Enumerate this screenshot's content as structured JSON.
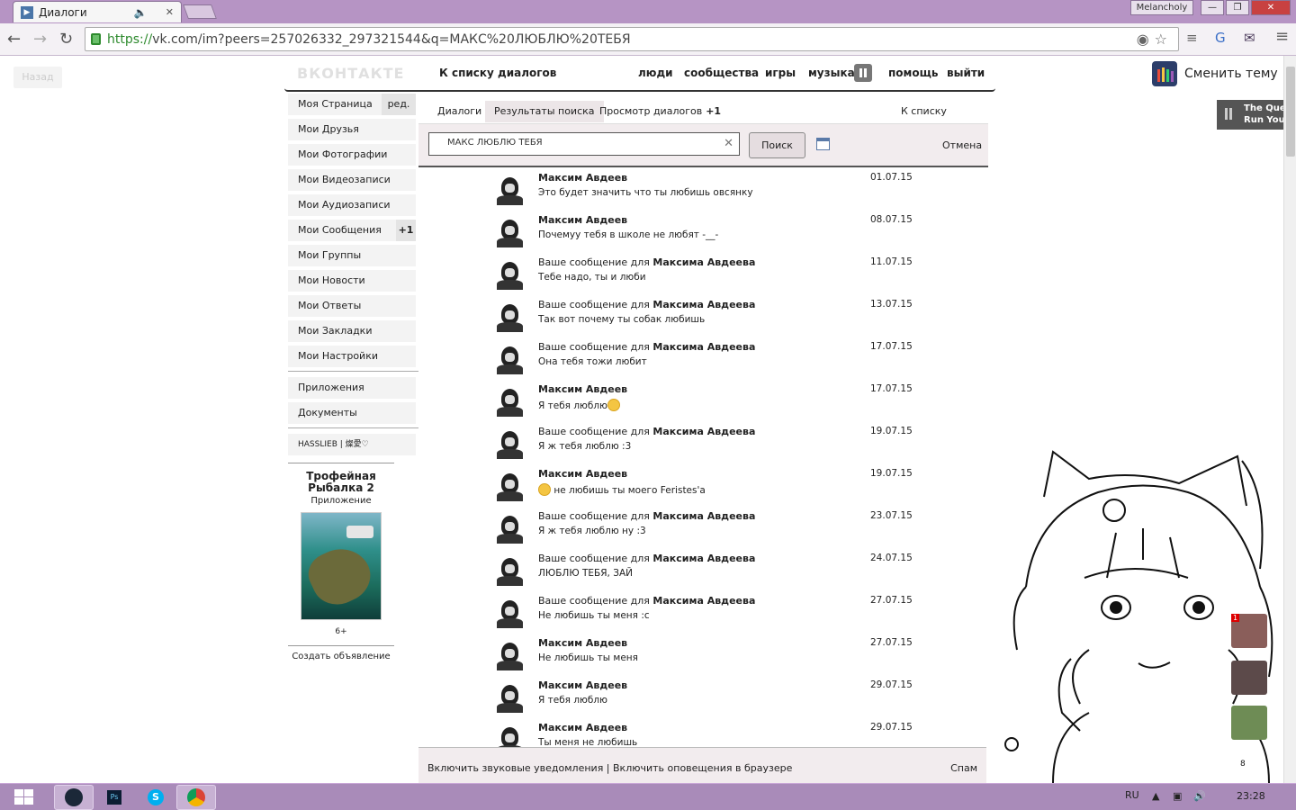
{
  "browser": {
    "tab_title": "Диалоги",
    "user": "Melancholy",
    "url_scheme": "https://",
    "url_rest": "vk.com/im?peers=257026332_297321544&q=МАКС%20ЛЮБЛЮ%20ТЕБЯ"
  },
  "page": {
    "back_label": "Назад",
    "logo": "ВКОНТАКТЕ",
    "to_dialogs": "К списку диалогов",
    "nav": [
      "люди",
      "сообщества",
      "игры",
      "музыка",
      "помощь",
      "выйти"
    ],
    "theme_label": "Сменить тему",
    "song": [
      "The Que",
      "Run You"
    ]
  },
  "sidebar": {
    "items": [
      {
        "label": "Моя Страница",
        "extra": "ред."
      },
      {
        "label": "Мои Друзья"
      },
      {
        "label": "Мои Фотографии"
      },
      {
        "label": "Мои Видеозаписи"
      },
      {
        "label": "Мои Аудиозаписи"
      },
      {
        "label": "Мои Сообщения",
        "count": "+1"
      },
      {
        "label": "Мои Группы"
      },
      {
        "label": "Мои Новости"
      },
      {
        "label": "Мои Ответы"
      },
      {
        "label": "Мои Закладки"
      },
      {
        "label": "Мои Настройки"
      }
    ],
    "apps": [
      "Приложения",
      "Документы"
    ],
    "group": "HASSLIEB | 燦愛♡",
    "ad": {
      "title": "Трофейная Рыбалка 2",
      "subtitle": "Приложение",
      "age": "6+",
      "create": "Создать объявление"
    }
  },
  "im": {
    "tabs": {
      "dialogs": "Диалоги",
      "search_results": "Результаты поиска",
      "view": "Просмотр диалогов",
      "view_count": "+1",
      "friends": "К списку друзей"
    },
    "search": {
      "value": "МАКС ЛЮБЛЮ ТЕБЯ",
      "button": "Поиск",
      "cancel": "Отмена"
    },
    "prefix": "Ваше сообщение для ",
    "results": [
      {
        "from": "Максим Авдеев",
        "to": "",
        "text": "Это будет значить что ты любишь овсянку",
        "date": "01.07.15"
      },
      {
        "from": "Максим Авдеев",
        "to": "",
        "text": "Почемуу тебя в школе не любят -__-",
        "date": "08.07.15"
      },
      {
        "from": "",
        "to": "Максима Авдеева",
        "text": "Тебе надо, ты и люби",
        "date": "11.07.15"
      },
      {
        "from": "",
        "to": "Максима Авдеева",
        "text": "Так вот почему ты собак любишь",
        "date": "13.07.15"
      },
      {
        "from": "",
        "to": "Максима Авдеева",
        "text": "Она тебя тожи любит",
        "date": "17.07.15"
      },
      {
        "from": "Максим Авдеев",
        "to": "",
        "text": "Я тебя  люблю",
        "date": "17.07.15",
        "emoji_after": true
      },
      {
        "from": "",
        "to": "Максима Авдеева",
        "text": "Я ж тебя  люблю :3",
        "date": "19.07.15"
      },
      {
        "from": "Максим Авдеев",
        "to": "",
        "text": " не любишь ты моего Feristes'a",
        "date": "19.07.15",
        "emoji_before": true
      },
      {
        "from": "",
        "to": "Максима Авдеева",
        "text": "Я ж тебя  люблю ну :3",
        "date": "23.07.15"
      },
      {
        "from": "",
        "to": "Максима Авдеева",
        "text": "ЛЮБЛЮ ТЕБЯ, ЗАЙ",
        "date": "24.07.15"
      },
      {
        "from": "",
        "to": "Максима Авдеева",
        "text": "Не любишь ты меня :с",
        "date": "27.07.15"
      },
      {
        "from": "Максим Авдеев",
        "to": "",
        "text": "Не любишь ты меня",
        "date": "27.07.15"
      },
      {
        "from": "Максим Авдеев",
        "to": "",
        "text": "Я тебя  люблю",
        "date": "29.07.15"
      },
      {
        "from": "Максим Авдеев",
        "to": "",
        "text": "Ты меня не любишь",
        "date": "29.07.15"
      }
    ],
    "footer": {
      "left": "Включить звуковые уведомления  |  Включить оповещения в браузере",
      "right": "Спам"
    }
  },
  "chat_sidebar": {
    "badge": "1",
    "online_count": "8"
  },
  "taskbar": {
    "lang": "RU",
    "time": "23:28"
  }
}
